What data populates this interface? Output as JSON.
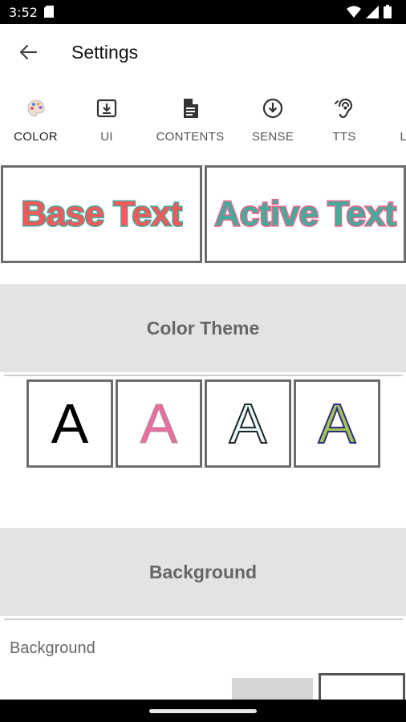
{
  "status_bar": {
    "time": "3:52"
  },
  "app_bar": {
    "title": "Settings"
  },
  "tabs": [
    {
      "label": "COLOR",
      "icon": "palette-icon",
      "active": true
    },
    {
      "label": "UI",
      "icon": "download-box-icon",
      "active": false
    },
    {
      "label": "CONTENTS",
      "icon": "document-icon",
      "active": false
    },
    {
      "label": "SENSE",
      "icon": "arrow-down-circle-icon",
      "active": false
    },
    {
      "label": "TTS",
      "icon": "ear-icon",
      "active": false
    },
    {
      "label": "LA",
      "icon": "",
      "active": false
    }
  ],
  "preview": {
    "base_text": "Base Text",
    "active_text": "Active Text"
  },
  "color_theme": {
    "title": "Color Theme",
    "options": [
      {
        "letter": "A",
        "fill": "#000000",
        "outline": "none"
      },
      {
        "letter": "A",
        "fill": "#f06aa0",
        "outline": "#999999"
      },
      {
        "letter": "A",
        "fill": "#e6fbfb",
        "outline": "#222222"
      },
      {
        "letter": "A",
        "fill": "#a2c45a",
        "outline": "#2e2e7a"
      }
    ]
  },
  "background": {
    "title": "Background",
    "label": "Background"
  },
  "colors": {
    "accent": "#6aaedb",
    "base_text_fill": "#f05a5a",
    "base_text_stroke": "#4aa89c",
    "active_text_fill": "#4aa89c",
    "active_text_stroke": "#e86a8c",
    "section_bg": "#e3e3e3"
  }
}
